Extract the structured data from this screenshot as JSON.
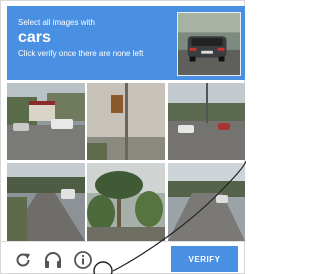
{
  "challenge": {
    "instruction": "Select all images with",
    "target": "cars",
    "hint": "Click verify once there are none left"
  },
  "grid": {
    "tiles": [
      {
        "label": "street-with-cars"
      },
      {
        "label": "sign-pole"
      },
      {
        "label": "road-with-cars"
      },
      {
        "label": "road-with-car"
      },
      {
        "label": "palm-tree"
      },
      {
        "label": "street-view"
      }
    ]
  },
  "footer": {
    "verify_label": "VERIFY",
    "icons": [
      "reload-icon",
      "audio-icon",
      "info-icon"
    ]
  },
  "colors": {
    "accent": "#4a90e2",
    "icon": "#555555"
  }
}
